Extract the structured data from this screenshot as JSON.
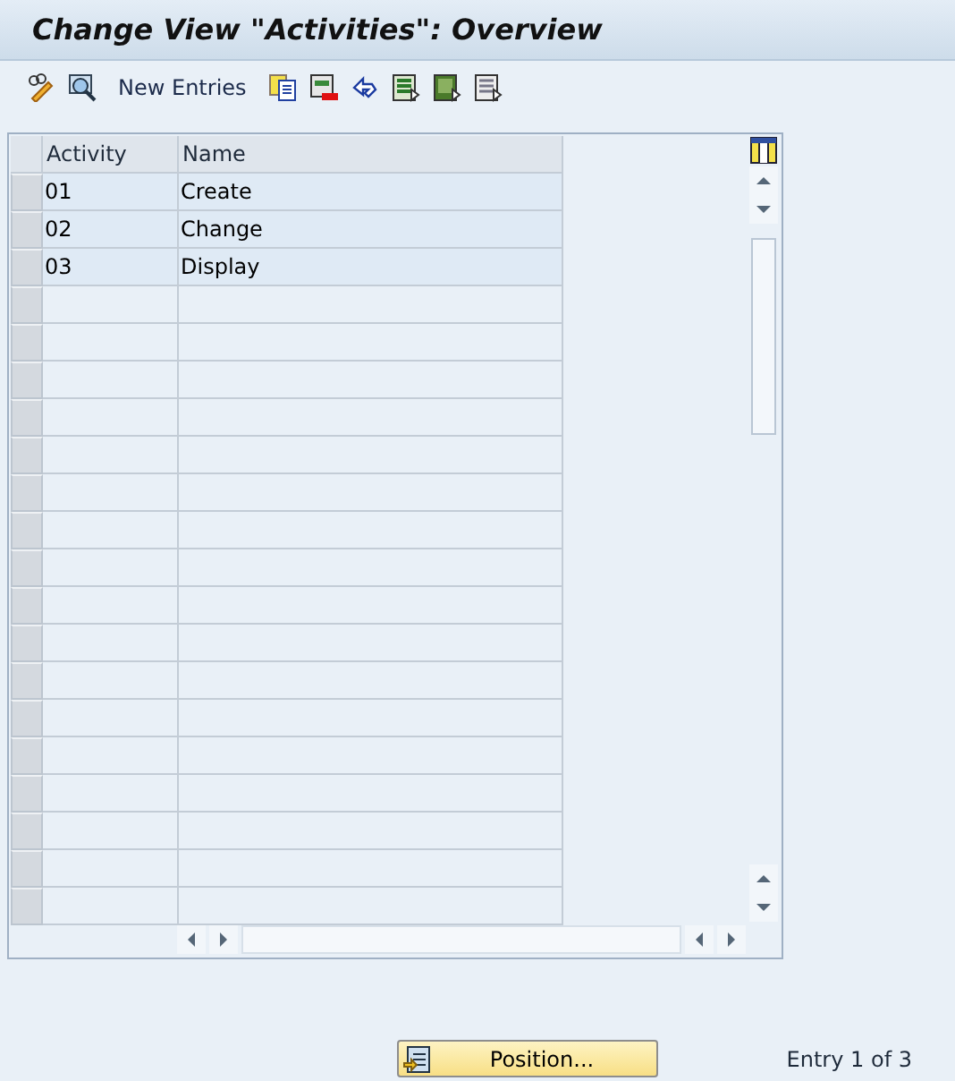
{
  "window": {
    "title": "Change View \"Activities\": Overview"
  },
  "toolbar": {
    "new_entries": "New Entries"
  },
  "table": {
    "columns": [
      "Activity",
      "Name"
    ],
    "rows": [
      {
        "activity": "01",
        "name": "Create"
      },
      {
        "activity": "02",
        "name": "Change"
      },
      {
        "activity": "03",
        "name": "Display"
      }
    ]
  },
  "footer": {
    "position_button": "Position...",
    "entry_info": "Entry 1 of 3"
  }
}
